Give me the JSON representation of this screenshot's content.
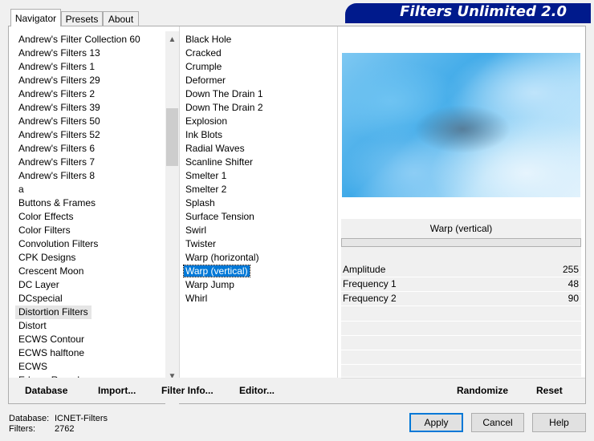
{
  "tabs": [
    {
      "label": "Navigator"
    },
    {
      "label": "Presets"
    },
    {
      "label": "About"
    }
  ],
  "banner_title": "Filters Unlimited 2.0",
  "categories": [
    "Andrew's Filter Collection 60",
    "Andrew's Filters 13",
    "Andrew's Filters 1",
    "Andrew's Filters 29",
    "Andrew's Filters 2",
    "Andrew's Filters 39",
    "Andrew's Filters 50",
    "Andrew's Filters 52",
    "Andrew's Filters 6",
    "Andrew's Filters 7",
    "Andrew's Filters 8",
    "a",
    "Buttons & Frames",
    "Color Effects",
    "Color Filters",
    "Convolution Filters",
    "CPK Designs",
    "Crescent Moon",
    "DC Layer",
    "DCspecial",
    "Distortion Filters",
    "Distort",
    "ECWS Contour",
    "ECWS halftone",
    "ECWS",
    "Edges, Round"
  ],
  "selected_category": "Distortion Filters",
  "filters": [
    "Black Hole",
    "Cracked",
    "Crumple",
    "Deformer",
    "Down The Drain 1",
    "Down The Drain 2",
    "Explosion",
    "Ink Blots",
    "Radial Waves",
    "Scanline Shifter",
    "Smelter 1",
    "Smelter 2",
    "Splash",
    "Surface Tension",
    "Swirl",
    "Twister",
    "Warp (horizontal)",
    "Warp (vertical)",
    "Warp Jump",
    "Whirl"
  ],
  "selected_filter": "Warp (vertical)",
  "params": {
    "title": "Warp (vertical)",
    "rows": [
      {
        "name": "Amplitude",
        "value": "255"
      },
      {
        "name": "Frequency 1",
        "value": "48"
      },
      {
        "name": "Frequency 2",
        "value": "90"
      }
    ]
  },
  "bottom_links": {
    "database": "Database",
    "import": "Import...",
    "filter_info": "Filter Info...",
    "editor": "Editor...",
    "randomize": "Randomize",
    "reset": "Reset"
  },
  "status": {
    "db_label": "Database:",
    "db_value": "ICNET-Filters",
    "filters_label": "Filters:",
    "filters_value": "2762"
  },
  "buttons": {
    "apply": "Apply",
    "cancel": "Cancel",
    "help": "Help"
  },
  "scroll": {
    "up_icon": "chevron-up-icon",
    "down_icon": "chevron-down-icon"
  }
}
